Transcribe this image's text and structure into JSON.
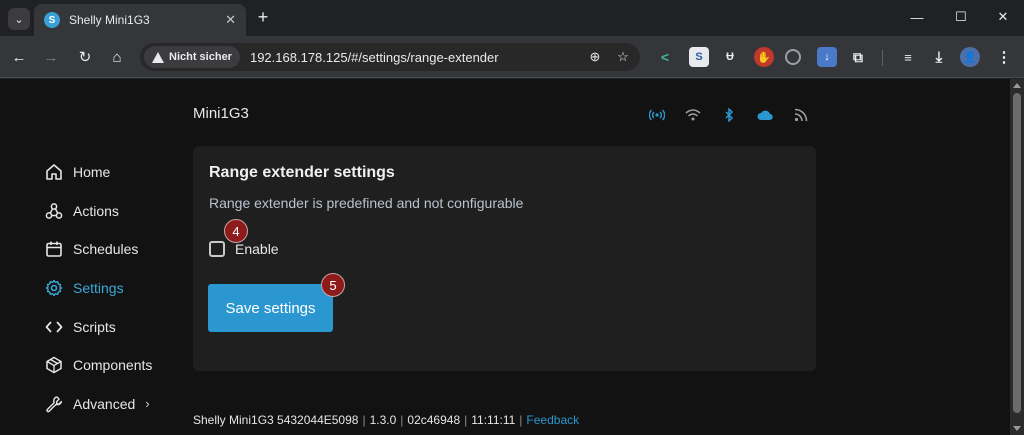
{
  "browser": {
    "tab_title": "Shelly Mini1G3",
    "new_tab": "+",
    "omnibox": {
      "security_label": "Nicht sicher",
      "url": "192.168.178.125/#/settings/range-extender"
    }
  },
  "page": {
    "device_name": "Mini1G3",
    "status_icons": [
      "ap-signal-icon",
      "wifi-icon",
      "bluetooth-icon",
      "cloud-icon",
      "rss-icon"
    ],
    "sidebar": {
      "items": [
        {
          "label": "Home",
          "icon": "home-icon",
          "active": false
        },
        {
          "label": "Actions",
          "icon": "actions-icon",
          "active": false
        },
        {
          "label": "Schedules",
          "icon": "calendar-icon",
          "active": false
        },
        {
          "label": "Settings",
          "icon": "gear-icon",
          "active": true
        },
        {
          "label": "Scripts",
          "icon": "code-icon",
          "active": false
        },
        {
          "label": "Components",
          "icon": "components-icon",
          "active": false
        },
        {
          "label": "Advanced",
          "icon": "wrench-icon",
          "active": false,
          "chevron": "›"
        }
      ]
    },
    "card": {
      "title": "Range extender settings",
      "description": "Range extender is predefined and not configurable",
      "enable_label": "Enable",
      "enable_checked": false,
      "save_label": "Save settings"
    },
    "badges": {
      "enable": "4",
      "save": "5"
    },
    "footer": {
      "device": "Shelly Mini1G3 5432044E5098",
      "version": "1.3.0",
      "build": "02c46948",
      "time": "11:11:11",
      "feedback": "Feedback",
      "separator": "|"
    },
    "colors": {
      "accent": "#2b97d0",
      "background": "#121212",
      "card": "#1f1f1f",
      "badge": "#8e1b1b"
    }
  }
}
